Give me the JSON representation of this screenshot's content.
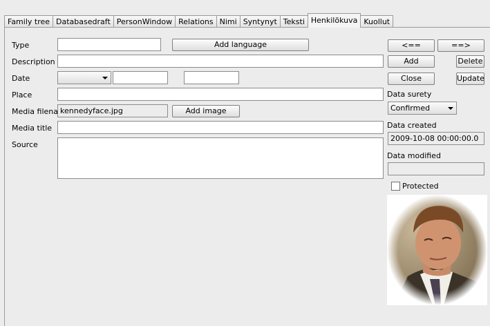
{
  "tabs": [
    "Family tree",
    "Databasedraft",
    "PersonWindow",
    "Relations",
    "Nimi",
    "Syntynyt",
    "Teksti",
    "Henkilökuva",
    "Kuollut"
  ],
  "active_tab": "Henkilökuva",
  "form": {
    "type_label": "Type",
    "type_value": "",
    "add_language_label": "Add language",
    "description_label": "Description",
    "description_value": "",
    "date_label": "Date",
    "date_qualifier": "",
    "date_from": "",
    "date_to": "",
    "place_label": "Place",
    "place_value": "",
    "media_filename_label": "Media filena...",
    "media_filename_value": "kennedyface.jpg",
    "add_image_label": "Add image",
    "media_title_label": "Media title",
    "media_title_value": "",
    "source_label": "Source",
    "source_value": ""
  },
  "side": {
    "prev_label": "<==",
    "next_label": "==>",
    "add_label": "Add",
    "delete_label": "Delete",
    "close_label": "Close",
    "update_label": "Update",
    "surety_label": "Data surety",
    "surety_value": "Confirmed",
    "created_label": "Data created",
    "created_value": "2009-10-08 00:00:00.0",
    "modified_label": "Data modified",
    "modified_value": "",
    "protected_label": "Protected",
    "protected_checked": false
  }
}
